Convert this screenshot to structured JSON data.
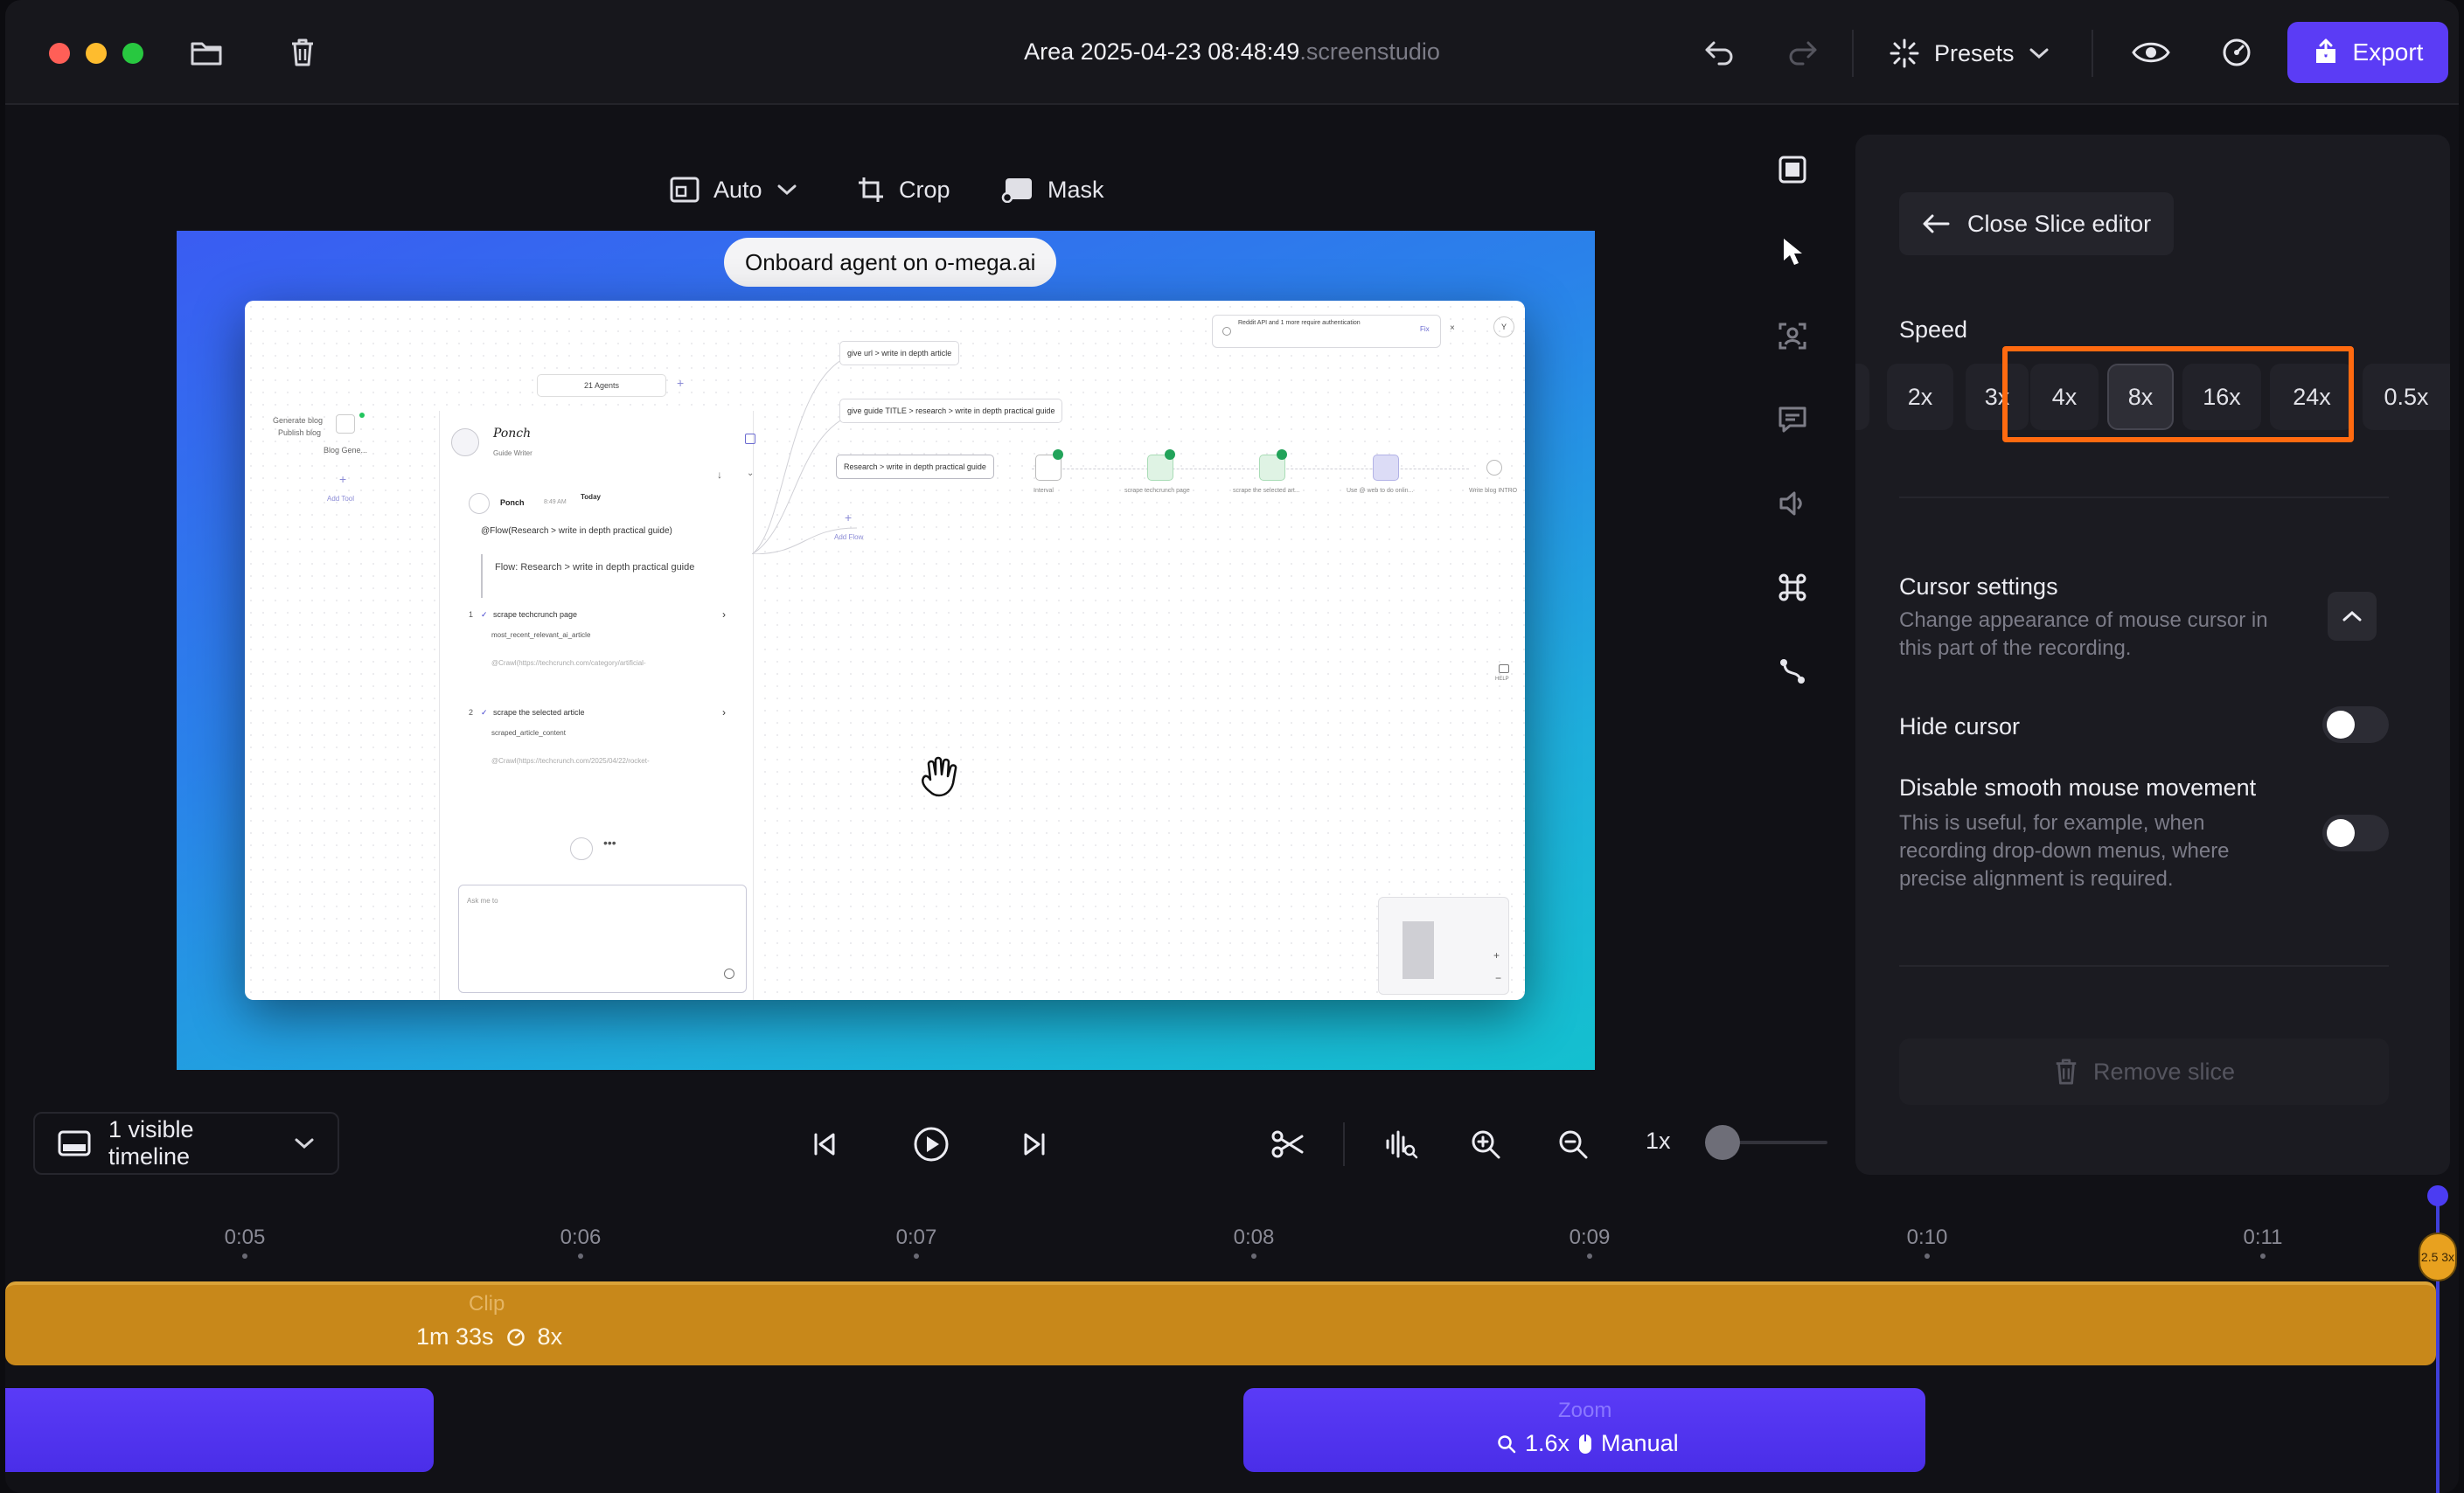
{
  "window": {
    "title": "Area 2025-04-23 08:48:49",
    "title_ext": ".screenstudio"
  },
  "toolbar": {
    "presets_label": "Presets",
    "export_label": "Export"
  },
  "canvas_tools": {
    "layout_label": "Auto",
    "crop_label": "Crop",
    "mask_label": "Mask"
  },
  "preview": {
    "title": "Onboard agent on o-mega.ai",
    "app": {
      "agents_count": "21 Agents",
      "sidebar_item_1": "Generate blog",
      "sidebar_item_2": "Publish blog",
      "sidebar_item_3": "Blog Gene...",
      "add_tool": "Add Tool",
      "agent_name": "Ponch",
      "agent_role": "Guide Writer",
      "msg_author": "Ponch",
      "msg_time": "8:49 AM",
      "msg_day": "Today",
      "msg_text": "@Flow(Research > write in depth practical guide)",
      "flow_text": "Flow: Research > write in depth practical guide",
      "step1_title": "scrape techcrunch page",
      "step1_sub": "most_recent_relevant_ai_article",
      "step1_url": "@Crawl(https://techcrunch.com/category/artificial-",
      "step2_title": "scrape the selected article",
      "step2_sub": "scraped_article_content",
      "step2_url": "@Crawl(https://techcrunch.com/2025/04/22/rocket-",
      "ask_placeholder": "Ask me to",
      "node1": "give url > write in depth article",
      "node2": "give guide TITLE > research > write in depth practical guide",
      "node3": "Research > write in depth practical guide",
      "add_flow": "Add Flow",
      "step_a": "Interval",
      "step_b": "scrape techcrunch page",
      "step_c": "scrape the selected art...",
      "step_d": "Use @ web to do onlin...",
      "step_e": "Write blog INTRO",
      "notice": "Reddit API and 1 more require authentication",
      "notice_fix": "Fix",
      "avatar_letter": "Y",
      "help": "HELP"
    }
  },
  "panel": {
    "close_label": "Close Slice editor",
    "speed_label": "Speed",
    "speeds": [
      "2x",
      "3x",
      "4x",
      "8x",
      "16x",
      "24x",
      "0.5x"
    ],
    "selected_speed": "8x",
    "cursor_title": "Cursor settings",
    "cursor_desc_1": "Change appearance of mouse cursor in",
    "cursor_desc_2": "this part of the recording.",
    "hide_cursor_label": "Hide cursor",
    "smooth_label": "Disable smooth mouse movement",
    "smooth_desc_1": "This is useful, for example, when",
    "smooth_desc_2": "recording drop-down menus, where",
    "smooth_desc_3": "precise alignment is required.",
    "remove_label": "Remove slice"
  },
  "playback": {
    "visible_timeline_label": "1 visible timeline",
    "speed_readout": "1x"
  },
  "timeline": {
    "ticks": [
      "0:05",
      "0:06",
      "0:07",
      "0:08",
      "0:09",
      "0:10",
      "0:11"
    ],
    "clip_name": "Clip",
    "clip_duration": "1m 33s",
    "clip_speed": "8x",
    "zoom_name": "Zoom",
    "zoom_level": "1.6x",
    "zoom_mode": "Manual",
    "playhead_label": "2.5 3x"
  },
  "colors": {
    "accent": "#5b3cf5",
    "clip": "#c8881a",
    "highlight": "#ff6a10"
  }
}
